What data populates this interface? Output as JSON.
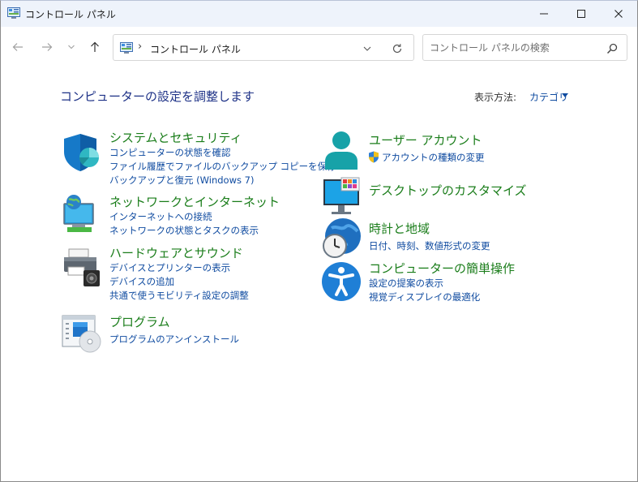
{
  "window": {
    "title": "コントロール パネル",
    "accent_color": "#1a7d1a",
    "link_color": "#0f4ba0"
  },
  "address": {
    "separator": "›",
    "path": "コントロール パネル"
  },
  "search": {
    "placeholder": "コントロール パネルの検索"
  },
  "content": {
    "heading": "コンピューターの設定を調整します",
    "view_by_label": "表示方法:",
    "view_by_value": "カテゴリ"
  },
  "categories": [
    {
      "icon": "shield-security-icon",
      "title": "システムとセキュリティ",
      "links": [
        "コンピューターの状態を確認",
        "ファイル履歴でファイルのバックアップ コピーを保存",
        "バックアップと復元 (Windows 7)"
      ]
    },
    {
      "icon": "network-globe-icon",
      "title": "ネットワークとインターネット",
      "links": [
        "インターネットへの接続",
        "ネットワークの状態とタスクの表示"
      ]
    },
    {
      "icon": "printer-speaker-icon",
      "title": "ハードウェアとサウンド",
      "links": [
        "デバイスとプリンターの表示",
        "デバイスの追加",
        "共通で使うモビリティ設定の調整"
      ]
    },
    {
      "icon": "programs-disc-icon",
      "title": "プログラム",
      "links": [
        "プログラムのアンインストール"
      ]
    },
    {
      "icon": "user-accounts-icon",
      "title": "ユーザー アカウント",
      "links": [
        "アカウントの種類の変更"
      ]
    },
    {
      "icon": "monitor-personalization-icon",
      "title": "デスクトップのカスタマイズ",
      "links": []
    },
    {
      "icon": "clock-globe-icon",
      "title": "時計と地域",
      "links": [
        "日付、時刻、数値形式の変更"
      ]
    },
    {
      "icon": "accessibility-icon",
      "title": "コンピューターの簡単操作",
      "links": [
        "設定の提案の表示",
        "視覚ディスプレイの最適化"
      ]
    }
  ]
}
